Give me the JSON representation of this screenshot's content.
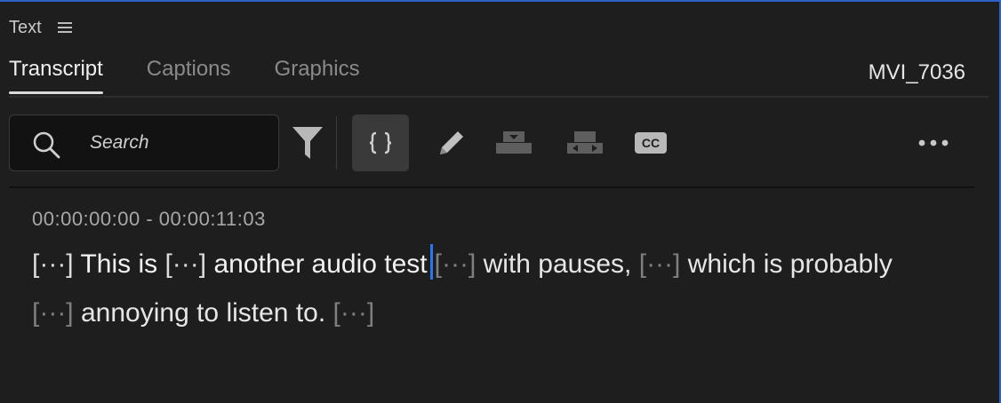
{
  "panel": {
    "title": "Text",
    "menu_icon": "hamburger-menu-icon"
  },
  "tabs": [
    {
      "label": "Transcript",
      "active": true
    },
    {
      "label": "Captions",
      "active": false
    },
    {
      "label": "Graphics",
      "active": false
    }
  ],
  "clip_name": "MVI_7036",
  "toolbar": {
    "search_placeholder": "Search",
    "search_icon": "search-icon",
    "filter_icon": "filter-icon",
    "split_icon": "split-segment-icon",
    "edit_icon": "pencil-icon",
    "merge_icon": "merge-segments-icon",
    "split_segments_icon": "split-segments-icon",
    "cc_icon": "cc-icon",
    "cc_label": "CC",
    "more_icon": "more-options-icon"
  },
  "transcript": {
    "timecode": "00:00:00:00 - 00:00:11:03",
    "pause_token": "[···]",
    "words": {
      "w1": "This is",
      "w2": "another audio test",
      "w3": "with pauses,",
      "w4": "which is",
      "w5": "probably",
      "w6": "annoying to listen to."
    }
  },
  "colors": {
    "accent": "#2a78f0",
    "border": "#2f62c9",
    "background": "#1e1e1e"
  }
}
